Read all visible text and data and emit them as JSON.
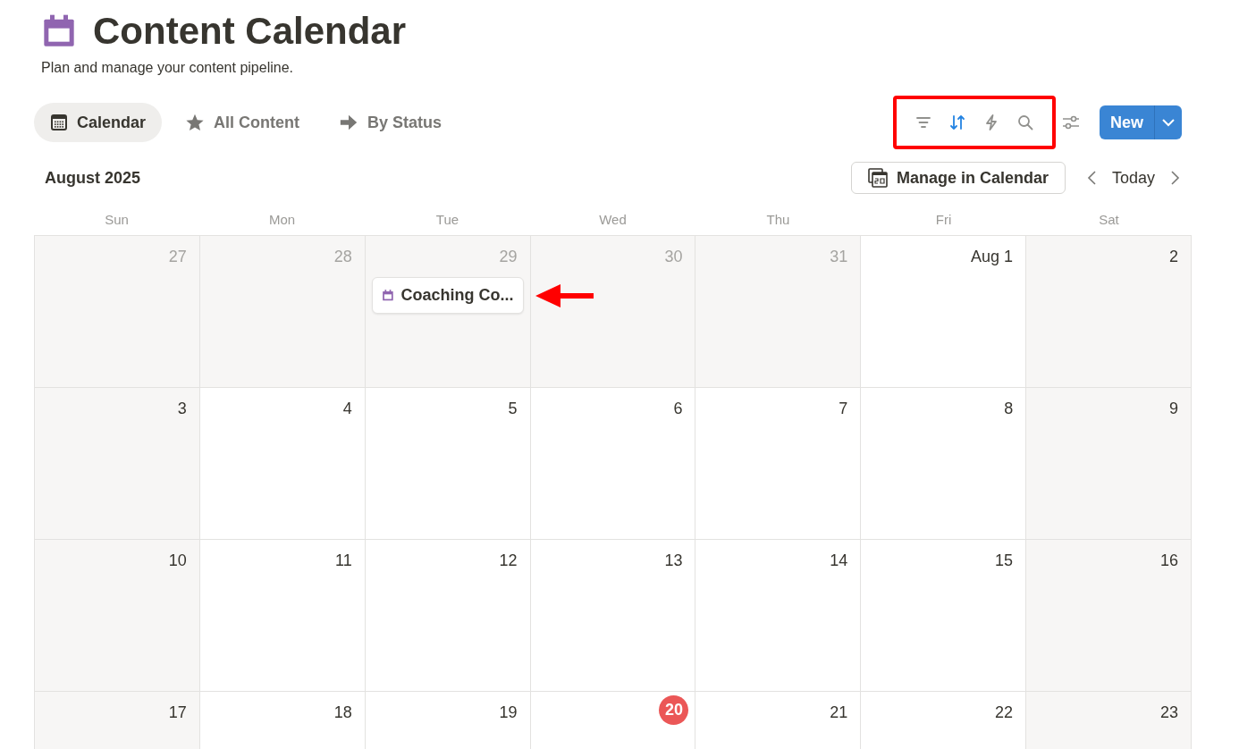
{
  "page": {
    "title": "Content Calendar",
    "description": "Plan and manage your content pipeline."
  },
  "views": [
    {
      "label": "Calendar",
      "kind": "calendar",
      "selected": true
    },
    {
      "label": "All Content",
      "kind": "star",
      "selected": false
    },
    {
      "label": "By Status",
      "kind": "arrow",
      "selected": false
    }
  ],
  "toolbar": {
    "tools": [
      {
        "kind": "filter",
        "active": false
      },
      {
        "kind": "sort",
        "active": true
      },
      {
        "kind": "automation",
        "active": false
      },
      {
        "kind": "search",
        "active": false
      }
    ],
    "highlighted": true,
    "new_button": "New"
  },
  "calendar": {
    "month": "August 2025",
    "manage_button": "Manage in Calendar",
    "today_button": "Today",
    "weekdays": [
      "Sun",
      "Mon",
      "Tue",
      "Wed",
      "Thu",
      "Fri",
      "Sat"
    ],
    "weeks": [
      [
        {
          "label": "27",
          "outside": true
        },
        {
          "label": "28",
          "outside": true
        },
        {
          "label": "29",
          "outside": true,
          "events": [
            {
              "title": "Coaching Co...",
              "pointed": true
            }
          ]
        },
        {
          "label": "30",
          "outside": true
        },
        {
          "label": "31",
          "outside": true
        },
        {
          "label": "Aug 1",
          "outside": false
        },
        {
          "label": "2",
          "outside": false
        }
      ],
      [
        {
          "label": "3",
          "outside": false
        },
        {
          "label": "4",
          "outside": false
        },
        {
          "label": "5",
          "outside": false
        },
        {
          "label": "6",
          "outside": false
        },
        {
          "label": "7",
          "outside": false
        },
        {
          "label": "8",
          "outside": false
        },
        {
          "label": "9",
          "outside": false
        }
      ],
      [
        {
          "label": "10",
          "outside": false
        },
        {
          "label": "11",
          "outside": false
        },
        {
          "label": "12",
          "outside": false
        },
        {
          "label": "13",
          "outside": false
        },
        {
          "label": "14",
          "outside": false
        },
        {
          "label": "15",
          "outside": false
        },
        {
          "label": "16",
          "outside": false
        }
      ],
      [
        {
          "label": "17",
          "outside": false
        },
        {
          "label": "18",
          "outside": false
        },
        {
          "label": "19",
          "outside": false
        },
        {
          "label": "20",
          "outside": false,
          "today": true
        },
        {
          "label": "21",
          "outside": false
        },
        {
          "label": "22",
          "outside": false
        },
        {
          "label": "23",
          "outside": false
        }
      ]
    ]
  }
}
